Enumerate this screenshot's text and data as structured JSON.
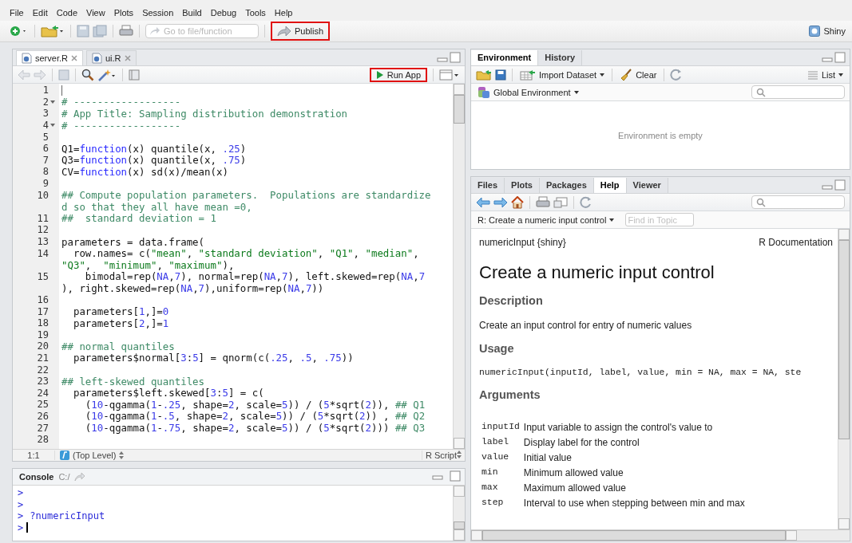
{
  "menu": [
    "File",
    "Edit",
    "Code",
    "View",
    "Plots",
    "Session",
    "Build",
    "Debug",
    "Tools",
    "Help"
  ],
  "toolbar": {
    "goto_placeholder": "Go to file/function",
    "publish": {
      "label": "Publish",
      "highlighted": true
    },
    "project": "Shiny"
  },
  "editor": {
    "tabs": [
      {
        "label": "server.R",
        "selected": true
      },
      {
        "label": "ui.R",
        "selected": false
      }
    ],
    "run_app": {
      "label": "Run App",
      "highlighted": true
    },
    "lines": [
      {
        "num": "1",
        "fold": false,
        "rows": [
          []
        ]
      },
      {
        "num": "2",
        "fold": true,
        "rows": [
          [
            {
              "kind": "comment",
              "text": "# ------------------"
            }
          ]
        ]
      },
      {
        "num": "3",
        "fold": false,
        "rows": [
          [
            {
              "kind": "comment",
              "text": "# App Title: Sampling distribution demonstration"
            }
          ]
        ]
      },
      {
        "num": "4",
        "fold": true,
        "rows": [
          [
            {
              "kind": "comment",
              "text": "# ------------------"
            }
          ]
        ]
      },
      {
        "num": "5",
        "fold": false,
        "rows": [
          []
        ]
      },
      {
        "num": "6",
        "fold": false,
        "rows": [
          [
            {
              "kind": "plain",
              "text": "Q1="
            },
            {
              "kind": "keyword",
              "text": "function"
            },
            {
              "kind": "plain",
              "text": "(x) quantile(x, "
            },
            {
              "kind": "number",
              "text": ".25"
            },
            {
              "kind": "plain",
              "text": ")"
            }
          ]
        ]
      },
      {
        "num": "7",
        "fold": false,
        "rows": [
          [
            {
              "kind": "plain",
              "text": "Q3="
            },
            {
              "kind": "keyword",
              "text": "function"
            },
            {
              "kind": "plain",
              "text": "(x) quantile(x, "
            },
            {
              "kind": "number",
              "text": ".75"
            },
            {
              "kind": "plain",
              "text": ")"
            }
          ]
        ]
      },
      {
        "num": "8",
        "fold": false,
        "rows": [
          [
            {
              "kind": "plain",
              "text": "CV="
            },
            {
              "kind": "keyword",
              "text": "function"
            },
            {
              "kind": "plain",
              "text": "(x) sd(x)/mean(x)"
            }
          ]
        ]
      },
      {
        "num": "9",
        "fold": false,
        "rows": [
          []
        ]
      },
      {
        "num": "10",
        "fold": false,
        "rows": [
          {
            "segments": [
              {
                "kind": "comment",
                "text": "## Compute population parameters.  Populations are standardize"
              }
            ]
          },
          {
            "segments": [
              {
                "kind": "comment",
                "text": "d so that they all have mean =0,"
              }
            ]
          }
        ]
      },
      {
        "num": "11",
        "fold": false,
        "rows": [
          [
            {
              "kind": "comment",
              "text": "##  standard deviation = 1"
            }
          ]
        ]
      },
      {
        "num": "12",
        "fold": false,
        "rows": [
          []
        ]
      },
      {
        "num": "13",
        "fold": false,
        "rows": [
          [
            {
              "kind": "plain",
              "text": "parameters = data.frame("
            }
          ]
        ]
      },
      {
        "num": "14",
        "fold": false,
        "rows": [
          {
            "segments": [
              {
                "kind": "plain",
                "text": "  row.names= c("
              },
              {
                "kind": "string",
                "text": "\"mean\""
              },
              {
                "kind": "plain",
                "text": ", "
              },
              {
                "kind": "string",
                "text": "\"standard deviation\""
              },
              {
                "kind": "plain",
                "text": ", "
              },
              {
                "kind": "string",
                "text": "\"Q1\""
              },
              {
                "kind": "plain",
                "text": ", "
              },
              {
                "kind": "string",
                "text": "\"median\""
              },
              {
                "kind": "plain",
                "text": ","
              }
            ]
          },
          {
            "segments": [
              {
                "kind": "string",
                "text": "\"Q3\""
              },
              {
                "kind": "plain",
                "text": ",  "
              },
              {
                "kind": "string",
                "text": "\"minimum\""
              },
              {
                "kind": "plain",
                "text": ", "
              },
              {
                "kind": "string",
                "text": "\"maximum\""
              },
              {
                "kind": "plain",
                "text": "),"
              }
            ]
          }
        ]
      },
      {
        "num": "15",
        "fold": false,
        "rows": [
          {
            "segments": [
              {
                "kind": "plain",
                "text": "    bimodal=rep("
              },
              {
                "kind": "number",
                "text": "NA"
              },
              {
                "kind": "plain",
                "text": ","
              },
              {
                "kind": "number",
                "text": "7"
              },
              {
                "kind": "plain",
                "text": "), normal=rep("
              },
              {
                "kind": "number",
                "text": "NA"
              },
              {
                "kind": "plain",
                "text": ","
              },
              {
                "kind": "number",
                "text": "7"
              },
              {
                "kind": "plain",
                "text": "), left.skewed=rep("
              },
              {
                "kind": "number",
                "text": "NA"
              },
              {
                "kind": "plain",
                "text": ","
              },
              {
                "kind": "number",
                "text": "7"
              }
            ]
          },
          {
            "segments": [
              {
                "kind": "plain",
                "text": "), right.skewed=rep("
              },
              {
                "kind": "number",
                "text": "NA"
              },
              {
                "kind": "plain",
                "text": ","
              },
              {
                "kind": "number",
                "text": "7"
              },
              {
                "kind": "plain",
                "text": "),uniform=rep("
              },
              {
                "kind": "number",
                "text": "NA"
              },
              {
                "kind": "plain",
                "text": ","
              },
              {
                "kind": "number",
                "text": "7"
              },
              {
                "kind": "plain",
                "text": "))"
              }
            ]
          }
        ]
      },
      {
        "num": "16",
        "fold": false,
        "rows": [
          []
        ]
      },
      {
        "num": "17",
        "fold": false,
        "rows": [
          [
            {
              "kind": "plain",
              "text": "  parameters["
            },
            {
              "kind": "number",
              "text": "1"
            },
            {
              "kind": "plain",
              "text": ",]="
            },
            {
              "kind": "number",
              "text": "0"
            }
          ]
        ]
      },
      {
        "num": "18",
        "fold": false,
        "rows": [
          [
            {
              "kind": "plain",
              "text": "  parameters["
            },
            {
              "kind": "number",
              "text": "2"
            },
            {
              "kind": "plain",
              "text": ",]="
            },
            {
              "kind": "number",
              "text": "1"
            }
          ]
        ]
      },
      {
        "num": "19",
        "fold": false,
        "rows": [
          []
        ]
      },
      {
        "num": "20",
        "fold": false,
        "rows": [
          [
            {
              "kind": "comment",
              "text": "## normal quantiles"
            }
          ]
        ]
      },
      {
        "num": "21",
        "fold": false,
        "rows": [
          [
            {
              "kind": "plain",
              "text": "  parameters$normal["
            },
            {
              "kind": "number",
              "text": "3"
            },
            {
              "kind": "plain",
              "text": ":"
            },
            {
              "kind": "number",
              "text": "5"
            },
            {
              "kind": "plain",
              "text": "] = qnorm(c("
            },
            {
              "kind": "number",
              "text": ".25"
            },
            {
              "kind": "plain",
              "text": ", "
            },
            {
              "kind": "number",
              "text": ".5"
            },
            {
              "kind": "plain",
              "text": ", "
            },
            {
              "kind": "number",
              "text": ".75"
            },
            {
              "kind": "plain",
              "text": "))"
            }
          ]
        ]
      },
      {
        "num": "22",
        "fold": false,
        "rows": [
          []
        ]
      },
      {
        "num": "23",
        "fold": false,
        "rows": [
          [
            {
              "kind": "comment",
              "text": "## left-skewed quantiles"
            }
          ]
        ]
      },
      {
        "num": "24",
        "fold": false,
        "rows": [
          [
            {
              "kind": "plain",
              "text": "  parameters$left.skewed["
            },
            {
              "kind": "number",
              "text": "3"
            },
            {
              "kind": "plain",
              "text": ":"
            },
            {
              "kind": "number",
              "text": "5"
            },
            {
              "kind": "plain",
              "text": "] = c("
            }
          ]
        ]
      },
      {
        "num": "25",
        "fold": false,
        "rows": [
          [
            {
              "kind": "plain",
              "text": "    ("
            },
            {
              "kind": "number",
              "text": "10"
            },
            {
              "kind": "plain",
              "text": "-qgamma("
            },
            {
              "kind": "number",
              "text": "1"
            },
            {
              "kind": "plain",
              "text": "-"
            },
            {
              "kind": "number",
              "text": ".25"
            },
            {
              "kind": "plain",
              "text": ", shape="
            },
            {
              "kind": "number",
              "text": "2"
            },
            {
              "kind": "plain",
              "text": ", scale="
            },
            {
              "kind": "number",
              "text": "5"
            },
            {
              "kind": "plain",
              "text": ")) / ("
            },
            {
              "kind": "number",
              "text": "5"
            },
            {
              "kind": "plain",
              "text": "*sqrt("
            },
            {
              "kind": "number",
              "text": "2"
            },
            {
              "kind": "plain",
              "text": ")), "
            },
            {
              "kind": "comment",
              "text": "## Q1"
            }
          ]
        ]
      },
      {
        "num": "26",
        "fold": false,
        "rows": [
          [
            {
              "kind": "plain",
              "text": "    ("
            },
            {
              "kind": "number",
              "text": "10"
            },
            {
              "kind": "plain",
              "text": "-qgamma("
            },
            {
              "kind": "number",
              "text": "1"
            },
            {
              "kind": "plain",
              "text": "-"
            },
            {
              "kind": "number",
              "text": ".5"
            },
            {
              "kind": "plain",
              "text": ", shape="
            },
            {
              "kind": "number",
              "text": "2"
            },
            {
              "kind": "plain",
              "text": ", scale="
            },
            {
              "kind": "number",
              "text": "5"
            },
            {
              "kind": "plain",
              "text": ")) / ("
            },
            {
              "kind": "number",
              "text": "5"
            },
            {
              "kind": "plain",
              "text": "*sqrt("
            },
            {
              "kind": "number",
              "text": "2"
            },
            {
              "kind": "plain",
              "text": ")) , "
            },
            {
              "kind": "comment",
              "text": "## Q2"
            }
          ]
        ]
      },
      {
        "num": "27",
        "fold": false,
        "rows": [
          [
            {
              "kind": "plain",
              "text": "    ("
            },
            {
              "kind": "number",
              "text": "10"
            },
            {
              "kind": "plain",
              "text": "-qgamma("
            },
            {
              "kind": "number",
              "text": "1"
            },
            {
              "kind": "plain",
              "text": "-"
            },
            {
              "kind": "number",
              "text": ".75"
            },
            {
              "kind": "plain",
              "text": ", shape="
            },
            {
              "kind": "number",
              "text": "2"
            },
            {
              "kind": "plain",
              "text": ", scale="
            },
            {
              "kind": "number",
              "text": "5"
            },
            {
              "kind": "plain",
              "text": ")) / ("
            },
            {
              "kind": "number",
              "text": "5"
            },
            {
              "kind": "plain",
              "text": "*sqrt("
            },
            {
              "kind": "number",
              "text": "2"
            },
            {
              "kind": "plain",
              "text": "))) "
            },
            {
              "kind": "comment",
              "text": "## Q3"
            }
          ]
        ]
      },
      {
        "num": "28",
        "fold": false,
        "rows": [
          []
        ]
      }
    ],
    "status": {
      "position": "1:1",
      "scope": "(Top Level)",
      "file_type": "R Script"
    }
  },
  "console": {
    "title": "Console",
    "path": "C:/",
    "lines": [
      {
        "prompt": ">",
        "cursor": false
      },
      {
        "prompt": ">",
        "cursor": false
      },
      {
        "prompt": ">",
        "command": "?numericInput",
        "cursor": false
      },
      {
        "prompt": ">",
        "cursor": true
      }
    ]
  },
  "environment": {
    "tabs": [
      {
        "label": "Environment",
        "selected": true
      },
      {
        "label": "History",
        "selected": false
      }
    ],
    "import_label": "Import Dataset",
    "clear_label": "Clear",
    "view_label": "List",
    "scope": "Global Environment",
    "empty_message": "Environment is empty"
  },
  "help_pane": {
    "tabs": [
      {
        "label": "Files",
        "selected": false
      },
      {
        "label": "Plots",
        "selected": false
      },
      {
        "label": "Packages",
        "selected": false
      },
      {
        "label": "Help",
        "selected": true
      },
      {
        "label": "Viewer",
        "selected": false
      }
    ],
    "topic": "R: Create a numeric input control",
    "find_placeholder": "Find in Topic",
    "doc": {
      "package": "numericInput {shiny}",
      "source": "R Documentation",
      "title": "Create a numeric input control",
      "description_heading": "Description",
      "description": "Create an input control for entry of numeric values",
      "usage_heading": "Usage",
      "usage": "numericInput(inputId, label, value, min = NA, max = NA, ste",
      "arguments_heading": "Arguments",
      "arguments": [
        {
          "name": "inputId",
          "description": "Input variable to assign the control's value to"
        },
        {
          "name": "label",
          "description": "Display label for the control"
        },
        {
          "name": "value",
          "description": "Initial value"
        },
        {
          "name": "min",
          "description": "Minimum allowed value"
        },
        {
          "name": "max",
          "description": "Maximum allowed value"
        },
        {
          "name": "step",
          "description": "Interval to use when stepping between min and max"
        }
      ]
    }
  }
}
